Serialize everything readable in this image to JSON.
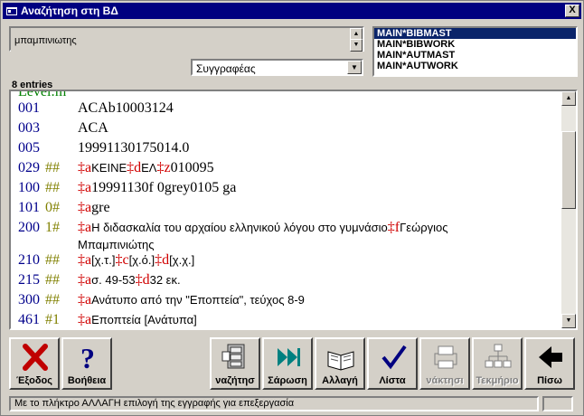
{
  "window": {
    "title": "Αναζήτηση στη ΒΔ",
    "close_label": "X"
  },
  "search": {
    "value": "μπαμπινιωτης"
  },
  "databases": {
    "items": [
      "MAIN*BIBMAST",
      "MAIN*BIBWORK",
      "MAIN*AUTMAST",
      "MAIN*AUTWORK"
    ],
    "selected": "MAIN*BIBMAST"
  },
  "field_select": {
    "value": "Συγγραφέας"
  },
  "entries_label": "8 entries",
  "record": {
    "level": "Level:m",
    "lines": [
      {
        "tag": "001",
        "ind": "",
        "value": "ACAb10003124"
      },
      {
        "tag": "003",
        "ind": "",
        "value": "ACA"
      },
      {
        "tag": "005",
        "ind": "",
        "value": "19991130175014.0"
      },
      {
        "tag": "029",
        "ind": "##",
        "parts": [
          [
            "‡a",
            "ΚΕΙΝΕ"
          ],
          [
            "‡d",
            "ΕΛ"
          ],
          [
            "‡z",
            "010095"
          ]
        ]
      },
      {
        "tag": "100",
        "ind": "##",
        "parts": [
          [
            "‡a",
            "19991130f           0grey0105    ga"
          ]
        ]
      },
      {
        "tag": "101",
        "ind": "0#",
        "parts": [
          [
            "‡a",
            "gre"
          ]
        ]
      },
      {
        "tag": "200",
        "ind": "1#",
        "parts": [
          [
            "‡a",
            "Η διδασκαλία του αρχαίου ελληνικού λόγου στο γυμνάσιο"
          ],
          [
            "‡f",
            "Γεώργιος"
          ]
        ],
        "cont": "Μπαμπινιώτης"
      },
      {
        "tag": "210",
        "ind": "##",
        "parts": [
          [
            "‡a",
            "[χ.τ.]"
          ],
          [
            "‡c",
            "[χ.ό.]"
          ],
          [
            "‡d",
            "[χ.χ.]"
          ]
        ]
      },
      {
        "tag": "215",
        "ind": "##",
        "parts": [
          [
            "‡a",
            "σ. 49-53"
          ],
          [
            "‡d",
            "32 εκ."
          ]
        ]
      },
      {
        "tag": "300",
        "ind": "##",
        "parts": [
          [
            "‡a",
            "Ανάτυπο από την \"Εποπτεία\", τεύχος 8-9"
          ]
        ]
      },
      {
        "tag": "461",
        "ind": "#1",
        "parts": [
          [
            "‡a",
            "Εποπτεία [Ανάτυπα]"
          ]
        ]
      }
    ]
  },
  "toolbar": {
    "exit": "Έξοδος",
    "help": "Βοήθεια",
    "search": "ναζήτησ",
    "scan": "Σάρωση",
    "edit": "Αλλαγή",
    "list": "Λίστα",
    "retrieve": "νάκτησι",
    "document": "Τεκμήριο",
    "back": "Πίσω"
  },
  "status": {
    "text": "Με το πλήκτρο ΑΛΛΑΓΗ επιλογή της εγγραφής για επεξεργασία"
  },
  "colors": {
    "title_bg": "#000080",
    "tag": "#00008b",
    "indicator": "#808000",
    "subfield": "#d00000",
    "level": "#008000"
  }
}
